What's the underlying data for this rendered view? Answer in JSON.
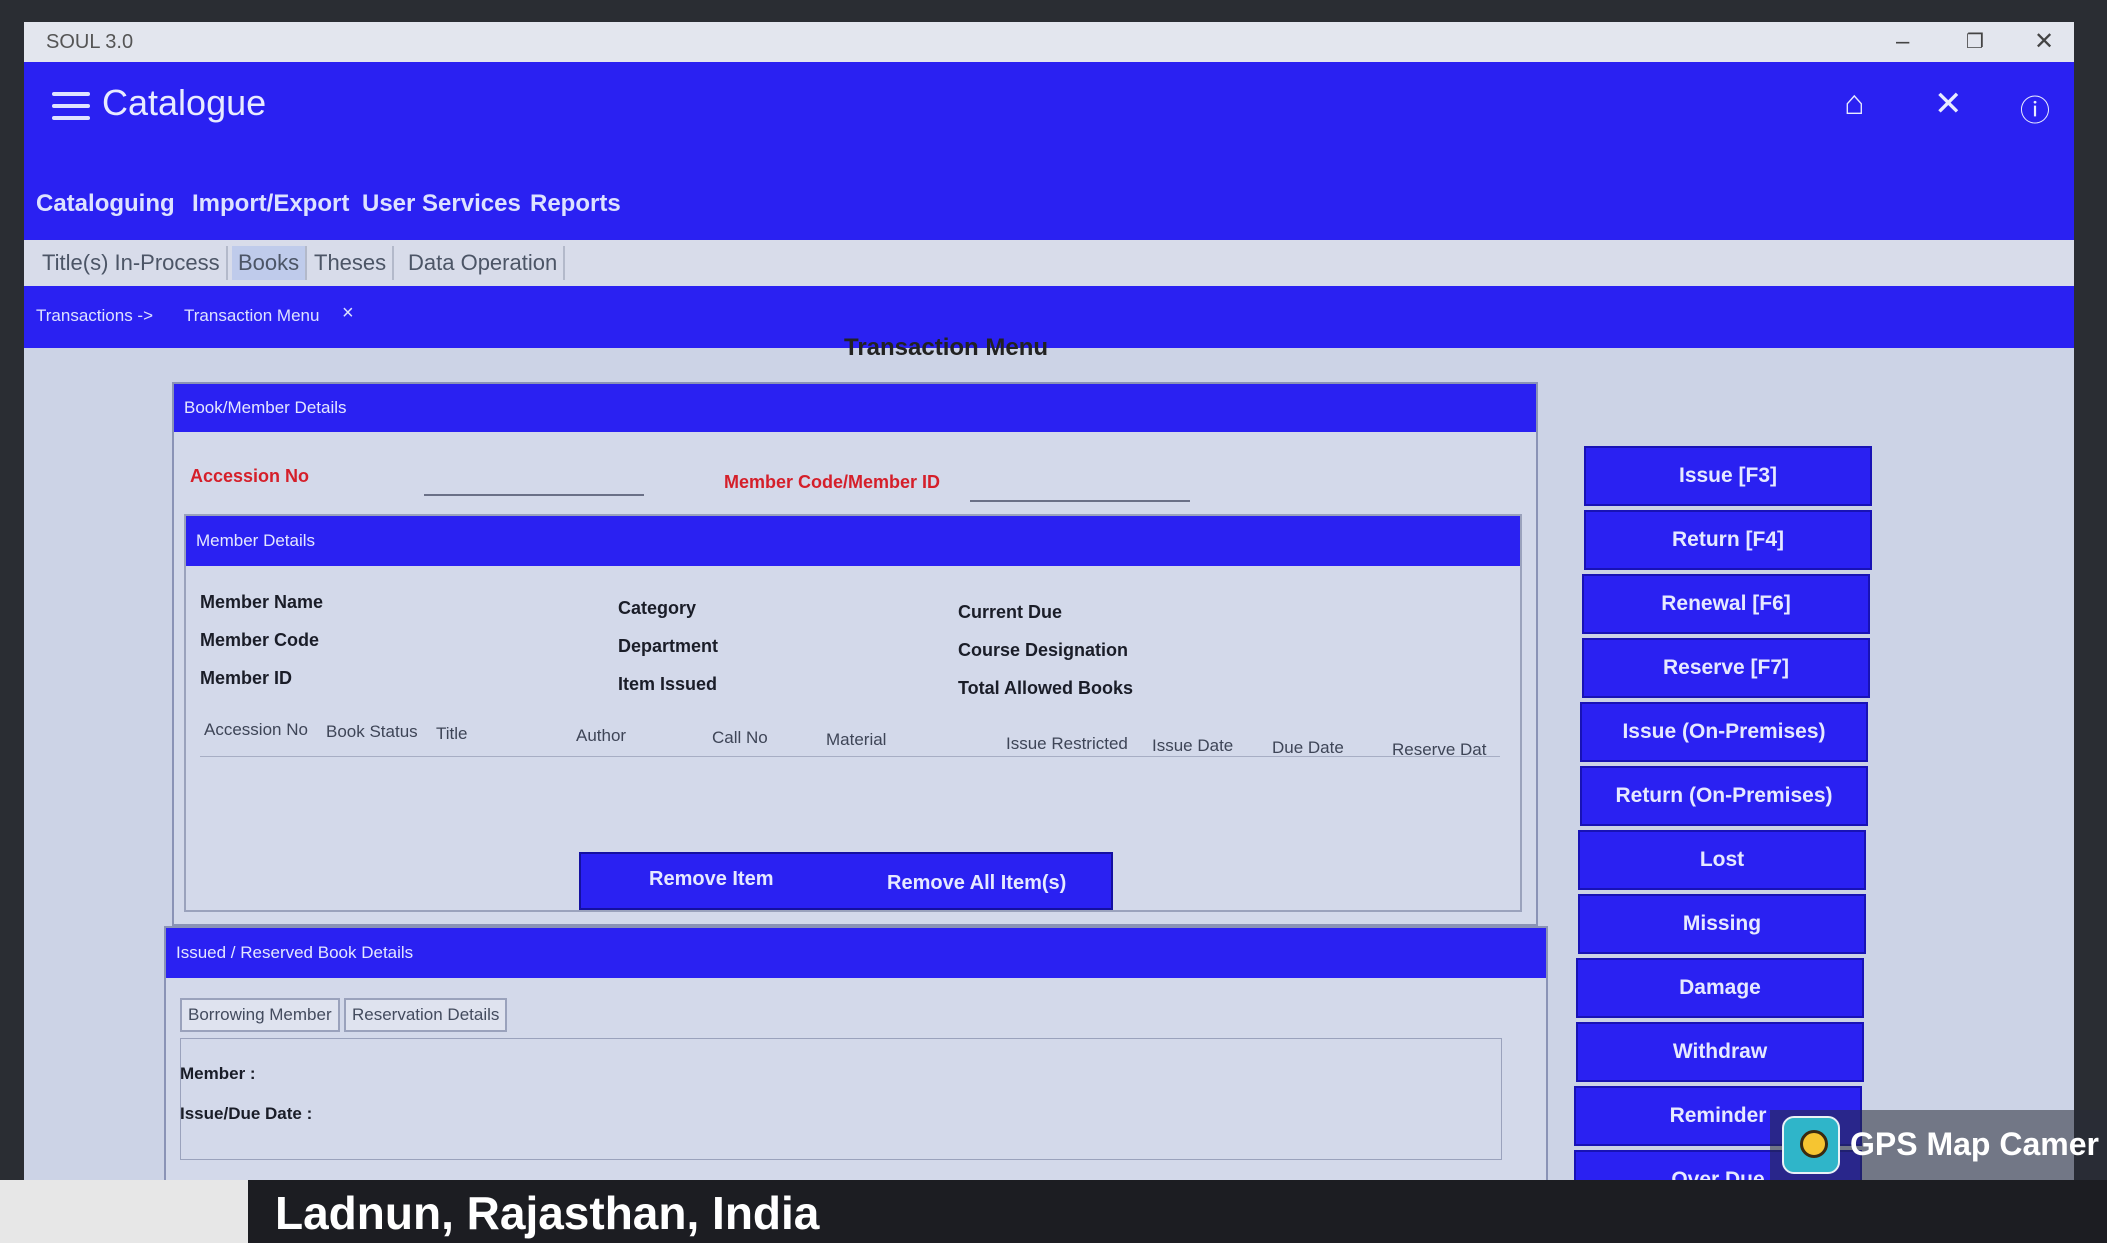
{
  "window": {
    "title": "SOUL 3.0"
  },
  "app": {
    "title": "Catalogue"
  },
  "menu": [
    "Cataloguing",
    "Import/Export",
    "User Services",
    "Reports"
  ],
  "tabs": [
    "Title(s) In-Process",
    "Books",
    "Theses",
    "Data Operation"
  ],
  "breadcrumb": {
    "root": "Transactions ->",
    "current": "Transaction Menu",
    "close": "×"
  },
  "page_title": "Transaction Menu",
  "book_member": {
    "header": "Book/Member Details",
    "accession_label": "Accession No",
    "member_code_label": "Member Code/Member ID"
  },
  "member_details": {
    "header": "Member Details",
    "fields": [
      "Member Name",
      "Member Code",
      "Member ID",
      "Category",
      "Department",
      "Item Issued",
      "Current Due",
      "Course Designation",
      "Total Allowed Books"
    ]
  },
  "table_columns": [
    "Accession No",
    "Book Status",
    "Title",
    "Author",
    "Call No",
    "Material",
    "Issue Restricted",
    "Issue Date",
    "Due Date",
    "Reserve Dat"
  ],
  "buttons": {
    "remove_item": "Remove Item",
    "remove_all": "Remove All Item(s)"
  },
  "issued_section": {
    "header": "Issued / Reserved Book Details",
    "tabs": [
      "Borrowing Member",
      "Reservation Details"
    ],
    "member_label": "Member :",
    "date_label": "Issue/Due Date :"
  },
  "actions": [
    "Issue [F3]",
    "Return [F4]",
    "Renewal [F6]",
    "Reserve [F7]",
    "Issue (On-Premises)",
    "Return (On-Premises)",
    "Lost",
    "Missing",
    "Damage",
    "Withdraw",
    "Reminder",
    "Over Due"
  ],
  "icons": {
    "home": "home-icon",
    "close": "close-icon",
    "help": "help-icon",
    "menu": "hamburger-icon"
  },
  "overlay": {
    "gps": "GPS Map Camer",
    "location": "Ladnun, Rajasthan, India"
  },
  "colors": {
    "primary": "#2a21f2",
    "label_red": "#d51f2a"
  }
}
